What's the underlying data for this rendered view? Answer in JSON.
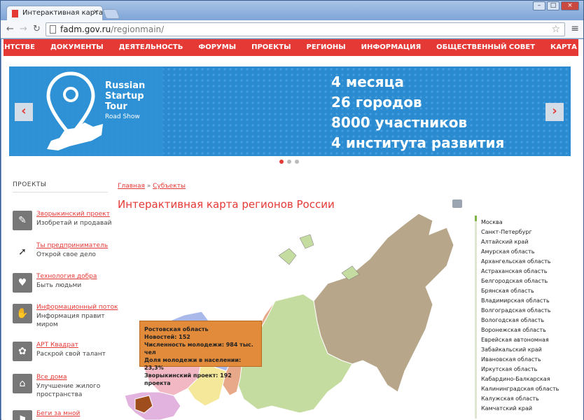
{
  "browser": {
    "tab_title": "Интерактивная карта регио",
    "url_host": "fadm.gov.ru",
    "url_path": "/regionmain/"
  },
  "nav": [
    "ОБ АГЕНТСТВЕ",
    "ДОКУМЕНТЫ",
    "ДЕЯТЕЛЬНОСТЬ",
    "ФОРУМЫ",
    "ПРОЕКТЫ",
    "РЕГИОНЫ",
    "ИНФОРМАЦИЯ",
    "ОБЩЕСТВЕННЫЙ СОВЕТ",
    "КАРТА САЙТА"
  ],
  "banner": {
    "brand_line1": "Russian",
    "brand_line2": "Startup",
    "brand_line3": "Tour",
    "brand_line4": "Road Show",
    "stat1": "4 месяца",
    "stat2": "26 городов",
    "stat3": "8000 участников",
    "stat4": "4 института развития"
  },
  "sidebar": {
    "title": "ПРОЕКТЫ",
    "projects": [
      {
        "title": "Зворыкинский проект",
        "desc": "Изобретай и продавай"
      },
      {
        "title": "Ты предприниматель",
        "desc": "Открой свое дело"
      },
      {
        "title": "Технология добра",
        "desc": "Быть людьми"
      },
      {
        "title": "Информационный поток",
        "desc": "Информация правит миром"
      },
      {
        "title": "АРТ Квадрат",
        "desc": "Раскрой свой талант"
      },
      {
        "title": "Все дома",
        "desc": "Улучшение жилого пространства"
      },
      {
        "title": "Беги за мной",
        "desc": ""
      }
    ]
  },
  "main": {
    "crumb_home": "Главная",
    "crumb_sep": "»",
    "crumb_current": "Субъекты",
    "title": "Интерактивная карта регионов России"
  },
  "tooltip": {
    "line1": "Ростовская область",
    "line2": "Новостей: 152",
    "line3": "Численность молодежи: 984 тыс. чел",
    "line4": "Доля молодежи в населении: 23,3%",
    "line5": "Зворыкинский  проект: 192 проекта"
  },
  "regions": [
    "Москва",
    "Санкт-Петербург",
    "Алтайский край",
    "Амурская область",
    "Архангельская область",
    "Астраханская область",
    "Белгородская область",
    "Брянская область",
    "Владимирская область",
    "Волгоградская область",
    "Вологодская область",
    "Воронежская область",
    "Еврейская автономная",
    "Забайкальский край",
    "Ивановская область",
    "Иркутская область",
    "Кабардино-Балкарская",
    "Калининградская область",
    "Калужская область",
    "Камчатский край"
  ]
}
